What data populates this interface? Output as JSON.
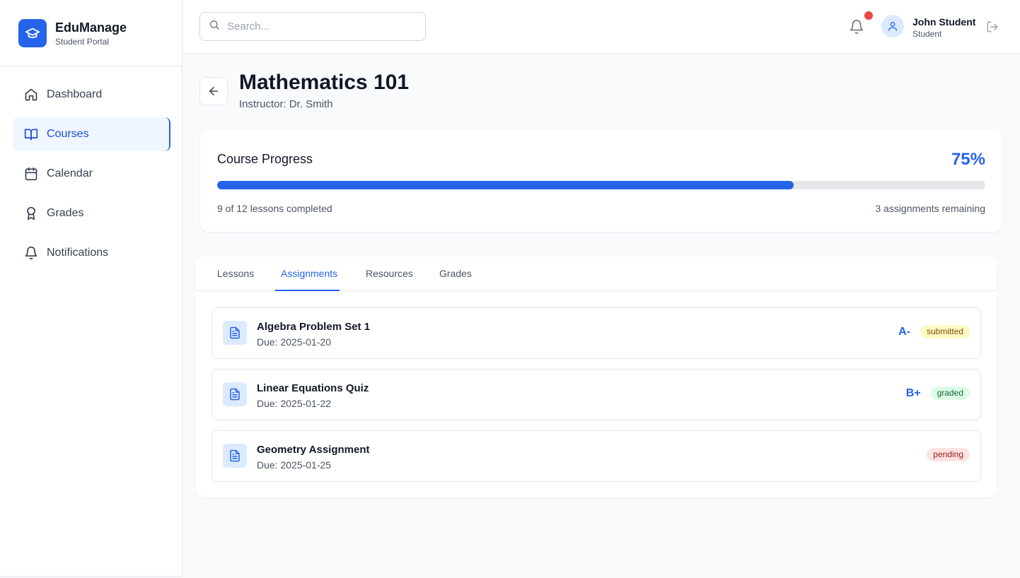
{
  "brand": {
    "title": "EduManage",
    "subtitle": "Student Portal",
    "icon": "graduation-cap-icon"
  },
  "sidebar": {
    "items": [
      {
        "label": "Dashboard",
        "icon": "home-icon",
        "active": false
      },
      {
        "label": "Courses",
        "icon": "book-open-icon",
        "active": true
      },
      {
        "label": "Calendar",
        "icon": "calendar-icon",
        "active": false
      },
      {
        "label": "Grades",
        "icon": "award-icon",
        "active": false
      },
      {
        "label": "Notifications",
        "icon": "bell-icon",
        "active": false
      }
    ]
  },
  "topbar": {
    "search_placeholder": "Search...",
    "user_name": "John Student",
    "user_role": "Student",
    "has_unread_notifications": true
  },
  "course": {
    "title": "Mathematics 101",
    "instructor": "Instructor: Dr. Smith"
  },
  "progress": {
    "title": "Course Progress",
    "percent_label": "75%",
    "percent": 75,
    "lessons_completed": "9 of 12 lessons completed",
    "assignments_remaining": "3 assignments remaining"
  },
  "tabs": [
    {
      "label": "Lessons",
      "active": false
    },
    {
      "label": "Assignments",
      "active": true
    },
    {
      "label": "Resources",
      "active": false
    },
    {
      "label": "Grades",
      "active": false
    }
  ],
  "assignments": [
    {
      "title": "Algebra Problem Set 1",
      "due": "Due: 2025-01-20",
      "grade": "A-",
      "status": "submitted"
    },
    {
      "title": "Linear Equations Quiz",
      "due": "Due: 2025-01-22",
      "grade": "B+",
      "status": "graded"
    },
    {
      "title": "Geometry Assignment",
      "due": "Due: 2025-01-25",
      "grade": "",
      "status": "pending"
    }
  ],
  "colors": {
    "accent": "#2563eb",
    "notification_dot": "#ef4444",
    "status_submitted_bg": "#fef9c3",
    "status_submitted_fg": "#854d0e",
    "status_graded_bg": "#dcfce7",
    "status_graded_fg": "#166534",
    "status_pending_bg": "#fee2e2",
    "status_pending_fg": "#991b1b"
  }
}
